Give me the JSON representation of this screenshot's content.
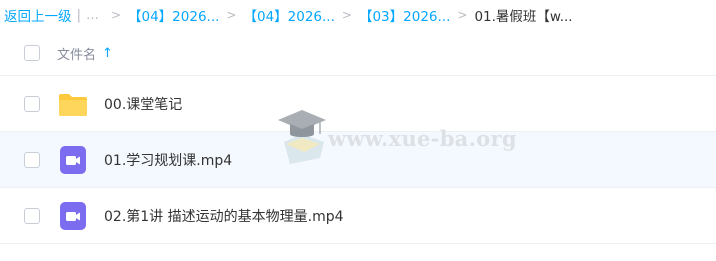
{
  "breadcrumb": {
    "back_label": "返回上一级",
    "divider": "|",
    "ellipsis": "...",
    "items": [
      "【04】2026...",
      "【04】2026...",
      "【03】2026..."
    ],
    "current": "01.暑假班【w..."
  },
  "header": {
    "name_column": "文件名",
    "sort_icon": "arrow-up-icon"
  },
  "files": [
    {
      "name": "00.课堂笔记",
      "icon": "folder-icon"
    },
    {
      "name": "01.学习规划课.mp4",
      "icon": "video-file-icon"
    },
    {
      "name": "02.第1讲 描述运动的基本物理量.mp4",
      "icon": "video-file-icon"
    }
  ],
  "watermark": {
    "text": "www.xue-ba.org"
  },
  "colors": {
    "accent": "#06a7ff",
    "folder": "#ffd24d",
    "video": "#7b6cf0"
  }
}
